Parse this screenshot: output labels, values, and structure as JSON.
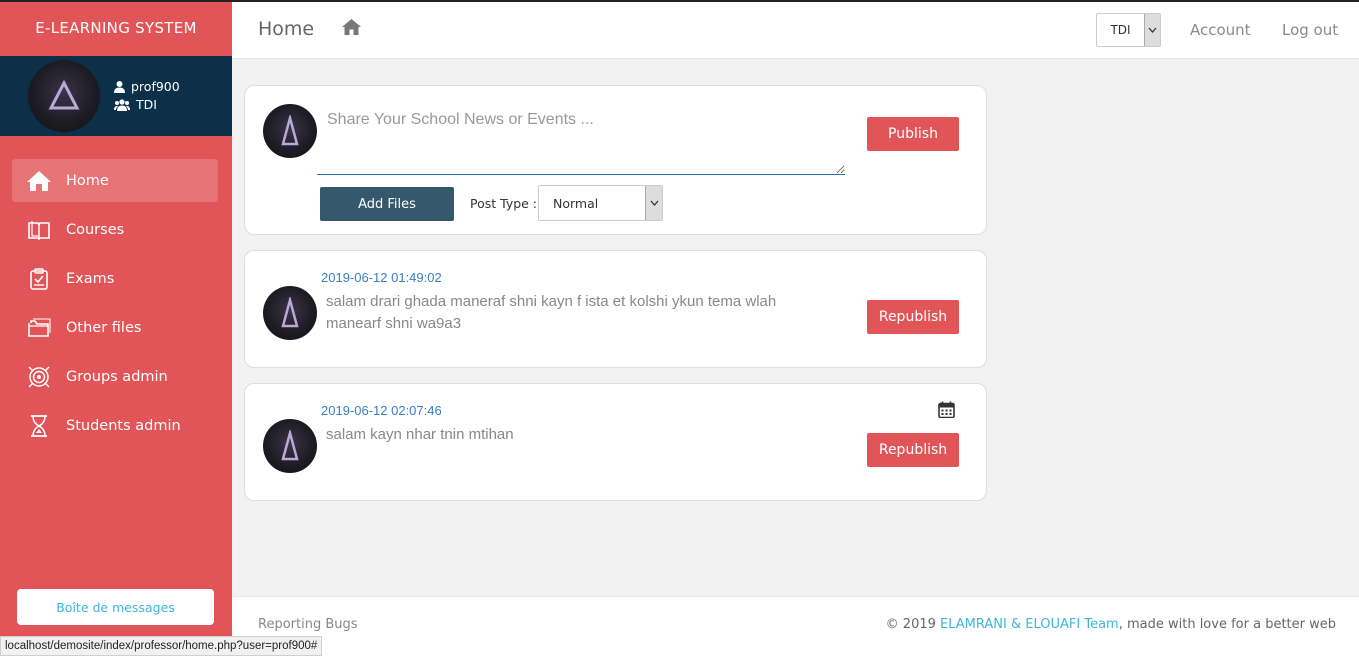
{
  "app": {
    "brand": "E-LEARNING SYSTEM"
  },
  "user": {
    "username": "prof900",
    "group": "TDI"
  },
  "sidebar": {
    "items": [
      {
        "label": "Home",
        "icon": "home-icon",
        "active": true
      },
      {
        "label": "Courses",
        "icon": "book-icon"
      },
      {
        "label": "Exams",
        "icon": "clipboard-icon"
      },
      {
        "label": "Other files",
        "icon": "folder-icon"
      },
      {
        "label": "Groups admin",
        "icon": "target-icon"
      },
      {
        "label": "Students admin",
        "icon": "trophy-icon"
      }
    ],
    "messages_button": "Boîte de messages"
  },
  "header": {
    "title": "Home",
    "class_select": "TDI",
    "account": "Account",
    "logout": "Log out"
  },
  "composer": {
    "placeholder": "Share Your School News or Events ...",
    "publish_label": "Publish",
    "add_files_label": "Add Files",
    "post_type_label": "Post Type :",
    "post_type_value": "Normal"
  },
  "posts": [
    {
      "date": "2019-06-12 01:49:02",
      "text": "salam drari ghada maneraf shni kayn f ista et kolshi ykun tema wlah manearf shni wa9a3",
      "action": "Republish"
    },
    {
      "date": "2019-06-12 02:07:46",
      "text": "salam kayn nhar tnin mtihan",
      "action": "Republish",
      "icon": "calendar-icon"
    }
  ],
  "footer": {
    "left": "Reporting Bugs",
    "copyright_prefix": "© 2019 ",
    "team": "ELAMRANI & ELOUAFI Team",
    "suffix": ", made with love for a better web"
  },
  "statusbar": {
    "url": "localhost/demosite/index/professor/home.php?user=prof900#"
  },
  "colors": {
    "sidebar": "#e15558",
    "profile_bg": "#0c3047",
    "button_red": "#e15558",
    "button_dark": "#35586c",
    "link_blue": "#3fb5d8",
    "date_blue": "#3a7ec0"
  }
}
